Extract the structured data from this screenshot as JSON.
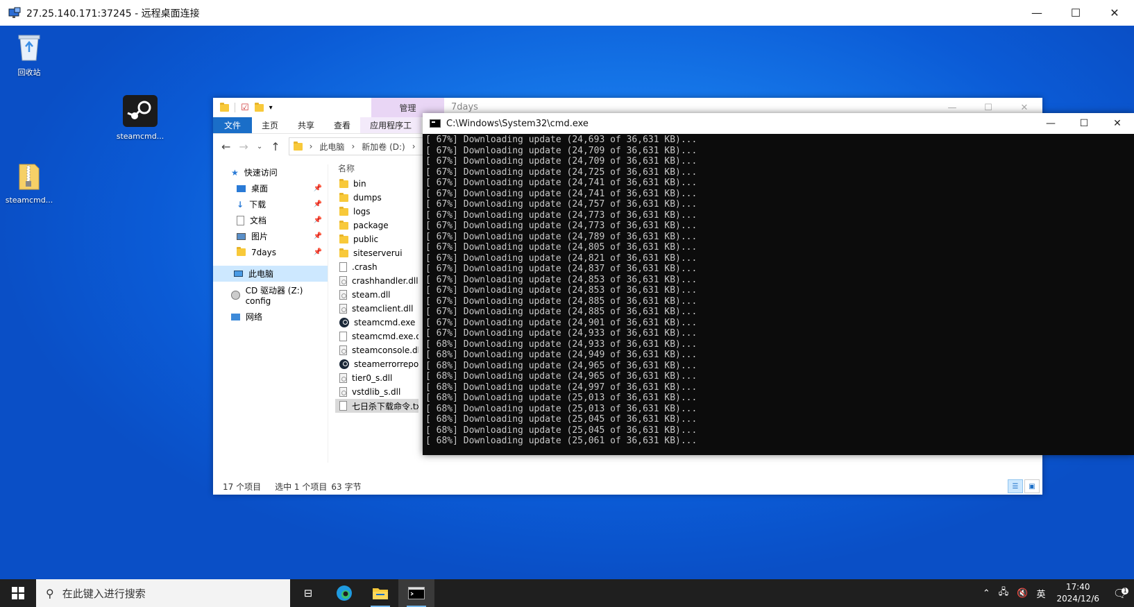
{
  "rdp": {
    "title": "27.25.140.171:37245 - 远程桌面连接",
    "controls": {
      "minimize": "—",
      "maximize": "☐",
      "close": "✕"
    }
  },
  "desktop": {
    "icons": [
      {
        "label": "回收站",
        "icon": "recycle-bin-icon"
      },
      {
        "label": "steamcmd...",
        "icon": "steam-icon"
      },
      {
        "label": "steamcmd...",
        "icon": "zip-folder-icon"
      }
    ]
  },
  "explorer": {
    "manage_tab": "管理",
    "folder_title": "7days",
    "ribbon_tabs": [
      "文件",
      "主页",
      "共享",
      "查看",
      "应用程序工"
    ],
    "breadcrumb": [
      "此电脑",
      "新加卷 (D:)"
    ],
    "nav": {
      "quick_access": "快速访问",
      "items": [
        {
          "label": "桌面",
          "icon": "desktop-icon"
        },
        {
          "label": "下载",
          "icon": "download-icon"
        },
        {
          "label": "文档",
          "icon": "documents-icon"
        },
        {
          "label": "图片",
          "icon": "pictures-icon"
        },
        {
          "label": "7days",
          "icon": "folder-icon"
        }
      ],
      "this_pc": "此电脑",
      "cd_drive": "CD 驱动器 (Z:) config",
      "network": "网络"
    },
    "column_header": "名称",
    "files": [
      {
        "name": "bin",
        "type": "folder"
      },
      {
        "name": "dumps",
        "type": "folder"
      },
      {
        "name": "logs",
        "type": "folder"
      },
      {
        "name": "package",
        "type": "folder"
      },
      {
        "name": "public",
        "type": "folder"
      },
      {
        "name": "siteserverui",
        "type": "folder"
      },
      {
        "name": ".crash",
        "type": "file"
      },
      {
        "name": "crashhandler.dll",
        "type": "dll"
      },
      {
        "name": "steam.dll",
        "type": "dll"
      },
      {
        "name": "steamclient.dll",
        "type": "dll"
      },
      {
        "name": "steamcmd.exe",
        "type": "exe"
      },
      {
        "name": "steamcmd.exe.old",
        "type": "file"
      },
      {
        "name": "steamconsole.dll",
        "type": "dll"
      },
      {
        "name": "steamerrorreporter.exe",
        "type": "steam"
      },
      {
        "name": "tier0_s.dll",
        "type": "dll"
      },
      {
        "name": "vstdlib_s.dll",
        "type": "dll"
      },
      {
        "name": "七日杀下载命令.txt",
        "type": "txt"
      }
    ],
    "status": {
      "count": "17 个项目",
      "selected": "选中 1 个项目",
      "size": "63 字节"
    }
  },
  "cmd": {
    "title": "C:\\Windows\\System32\\cmd.exe",
    "lines": [
      "[ 67%] Downloading update (24,693 of 36,631 KB)...",
      "[ 67%] Downloading update (24,709 of 36,631 KB)...",
      "[ 67%] Downloading update (24,709 of 36,631 KB)...",
      "[ 67%] Downloading update (24,725 of 36,631 KB)...",
      "[ 67%] Downloading update (24,741 of 36,631 KB)...",
      "[ 67%] Downloading update (24,741 of 36,631 KB)...",
      "[ 67%] Downloading update (24,757 of 36,631 KB)...",
      "[ 67%] Downloading update (24,773 of 36,631 KB)...",
      "[ 67%] Downloading update (24,773 of 36,631 KB)...",
      "[ 67%] Downloading update (24,789 of 36,631 KB)...",
      "[ 67%] Downloading update (24,805 of 36,631 KB)...",
      "[ 67%] Downloading update (24,821 of 36,631 KB)...",
      "[ 67%] Downloading update (24,837 of 36,631 KB)...",
      "[ 67%] Downloading update (24,853 of 36,631 KB)...",
      "[ 67%] Downloading update (24,853 of 36,631 KB)...",
      "[ 67%] Downloading update (24,885 of 36,631 KB)...",
      "[ 67%] Downloading update (24,885 of 36,631 KB)...",
      "[ 67%] Downloading update (24,901 of 36,631 KB)...",
      "[ 67%] Downloading update (24,933 of 36,631 KB)...",
      "[ 68%] Downloading update (24,933 of 36,631 KB)...",
      "[ 68%] Downloading update (24,949 of 36,631 KB)...",
      "[ 68%] Downloading update (24,965 of 36,631 KB)...",
      "[ 68%] Downloading update (24,965 of 36,631 KB)...",
      "[ 68%] Downloading update (24,997 of 36,631 KB)...",
      "[ 68%] Downloading update (25,013 of 36,631 KB)...",
      "[ 68%] Downloading update (25,013 of 36,631 KB)...",
      "[ 68%] Downloading update (25,045 of 36,631 KB)...",
      "[ 68%] Downloading update (25,045 of 36,631 KB)...",
      "[ 68%] Downloading update (25,061 of 36,631 KB)..."
    ]
  },
  "taskbar": {
    "search_placeholder": "在此键入进行搜索",
    "ime": "英",
    "time": "17:40",
    "date": "2024/12/6",
    "notification_count": "1"
  }
}
